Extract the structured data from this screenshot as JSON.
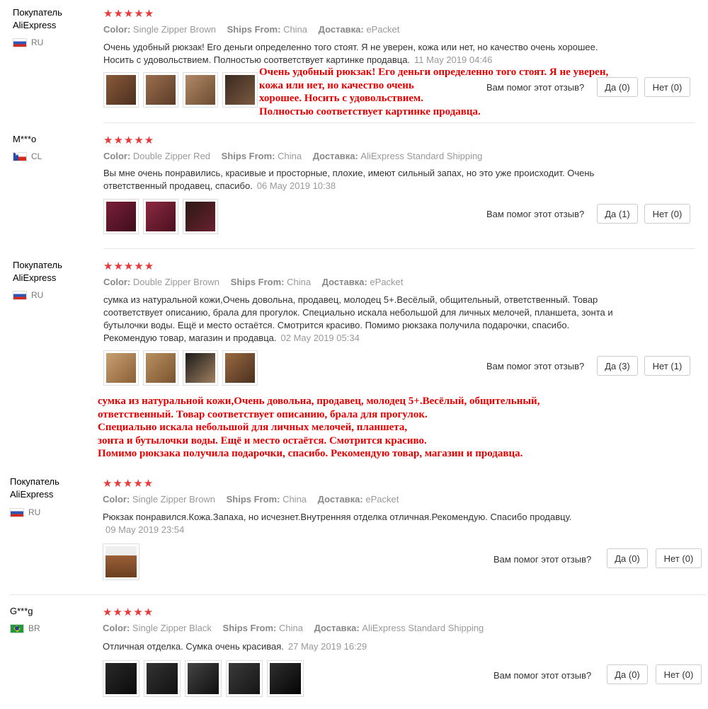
{
  "colors": {
    "star": "#e93a3a",
    "overlay_text": "#e80000"
  },
  "labels": {
    "color": "Color:",
    "ships_from": "Ships From:",
    "delivery": "Доставка:",
    "helpful_question": "Вам помог этот отзыв?"
  },
  "stars": "★★★★★",
  "reviews": [
    {
      "user": [
        "Покупатель",
        "AliExpress"
      ],
      "country": "RU",
      "color": "Single Zipper Brown",
      "ships_from": "China",
      "delivery": "ePacket",
      "text": "Очень удобный рюкзак! Его деньги определенно того стоят. Я не уверен, кожа или нет, но качество очень хорошее. Носить с удовольствием. Полностью соответствует картинке продавца.",
      "date": "11 May 2019 04:46",
      "yes": "Да (0)",
      "no": "Нет (0)"
    },
    {
      "user": [
        "M***o"
      ],
      "country": "CL",
      "color": "Double Zipper Red",
      "ships_from": "China",
      "delivery": "AliExpress Standard Shipping",
      "text": "Вы мне очень понравились, красивые и просторные, плохие, имеют сильный запах, но это уже происходит. Очень ответственный продавец, спасибо.",
      "date": "06 May 2019 10:38",
      "yes": "Да (1)",
      "no": "Нет (0)"
    },
    {
      "user": [
        "Покупатель",
        "AliExpress"
      ],
      "country": "RU",
      "color": "Double Zipper Brown",
      "ships_from": "China",
      "delivery": "ePacket",
      "text": "сумка из натуральной кожи,Очень довольна, продавец, молодец 5+.Весёлый, общительный, ответственный. Товар соответствует описанию, брала для прогулок. Специально искала небольшой для личных мелочей, планшета, зонта и бутылочки воды. Ещё и место остаётся. Смотрится красиво. Помимо рюкзака получила подарочки, спасибо. Рекомендую товар, магазин и продавца.",
      "date": "02 May 2019 05:34",
      "yes": "Да (3)",
      "no": "Нет (1)"
    },
    {
      "user": [
        "Покупатель",
        "AliExpress"
      ],
      "country": "RU",
      "color": "Single Zipper Brown",
      "ships_from": "China",
      "delivery": "ePacket",
      "text": "Рюкзак понравился.Кожа.Запаха, но исчезнет.Внутренняя отделка отличная.Рекомендую. Спасибо продавцу.",
      "date": "09 May 2019 23:54",
      "yes": "Да (0)",
      "no": "Нет (0)"
    },
    {
      "user": [
        "G***g"
      ],
      "country": "BR",
      "color": "Single Zipper Black",
      "ships_from": "China",
      "delivery": "AliExpress Standard Shipping",
      "text": "Отличная отделка. Сумка очень красивая.",
      "date": "27 May 2019 16:29",
      "yes": "Да (0)",
      "no": "Нет (0)"
    }
  ],
  "overlay1": [
    "Очень удобный рюкзак! Его деньги определенно того стоят. Я не уверен,",
    "кожа или нет, но качество очень",
    "хорошее. Носить с удовольствием.",
    "Полностью соответствует картинке продавца."
  ],
  "overlay2": [
    "сумка из натуральной кожи,Очень довольна, продавец, молодец 5+.Весёлый, общительный,",
    "ответственный. Товар соответствует описанию, брала для прогулок.",
    "Специально искала небольшой для личных мелочей, планшета,",
    "зонта и бутылочки воды. Ещё и место остаётся. Смотрится красиво.",
    "Помимо рюкзака получила подарочки, спасибо. Рекомендую товар, магазин и продавца."
  ]
}
